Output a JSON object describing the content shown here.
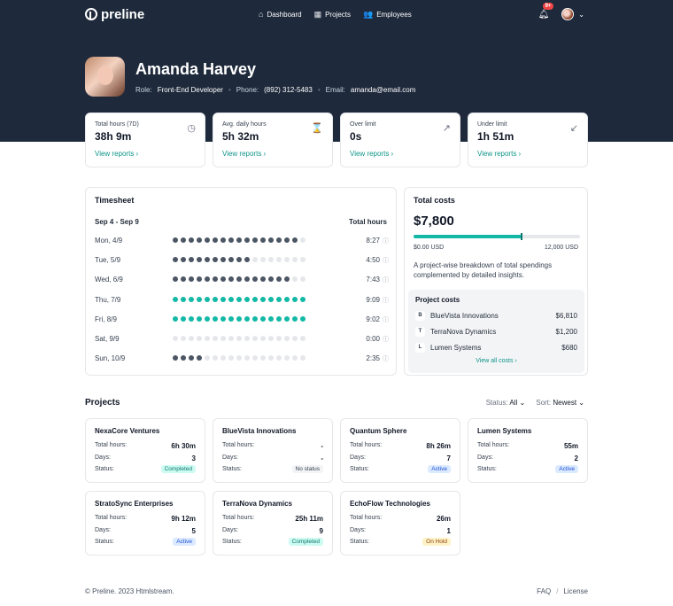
{
  "nav": {
    "brand": "preline",
    "links": [
      {
        "label": "Dashboard",
        "icon": "home-icon",
        "glyph": "⌂"
      },
      {
        "label": "Projects",
        "icon": "building-icon",
        "glyph": "▦"
      },
      {
        "label": "Employees",
        "icon": "users-icon",
        "glyph": "👥"
      }
    ],
    "notification_count": "9+"
  },
  "profile": {
    "name": "Amanda Harvey",
    "role_label": "Role:",
    "role": "Front-End Developer",
    "phone_label": "Phone:",
    "phone": "(892) 312-5483",
    "email_label": "Email:",
    "email": "amanda@email.com"
  },
  "stats": [
    {
      "label": "Total hours (7D)",
      "value": "38h 9m",
      "link": "View reports",
      "icon": "calendar-clock-icon",
      "glyph": "◷"
    },
    {
      "label": "Avg. daily hours",
      "value": "5h 32m",
      "link": "View reports",
      "icon": "hourglass-icon",
      "glyph": "⌛"
    },
    {
      "label": "Over limit",
      "value": "0s",
      "link": "View reports",
      "icon": "arrow-up-right-circle-icon",
      "glyph": "↗"
    },
    {
      "label": "Under limit",
      "value": "1h 51m",
      "link": "View reports",
      "icon": "arrow-down-left-circle-icon",
      "glyph": "↙"
    }
  ],
  "timesheet": {
    "title": "Timesheet",
    "range": "Sep 4 - Sep 9",
    "total_label": "Total hours",
    "rows": [
      {
        "day": "Mon, 4/9",
        "hours": "8:27",
        "filled": 16,
        "color": "dark"
      },
      {
        "day": "Tue, 5/9",
        "hours": "4:50",
        "filled": 10,
        "color": "dark"
      },
      {
        "day": "Wed, 6/9",
        "hours": "7:43",
        "filled": 15,
        "color": "dark"
      },
      {
        "day": "Thu, 7/9",
        "hours": "9:09",
        "filled": 17,
        "color": "teal"
      },
      {
        "day": "Fri, 8/9",
        "hours": "9:02",
        "filled": 17,
        "color": "teal"
      },
      {
        "day": "Sat, 9/9",
        "hours": "0:00",
        "filled": 0,
        "color": "dark"
      },
      {
        "day": "Sun, 10/9",
        "hours": "2:35",
        "filled": 4,
        "color": "dark"
      }
    ],
    "dot_count": 17
  },
  "costs": {
    "title": "Total costs",
    "amount": "$7,800",
    "progress_fraction": 0.65,
    "min": "$0.00 USD",
    "max": "12,000 USD",
    "description": "A project-wise breakdown of total spendings complemented by detailed insights.",
    "projects_title": "Project costs",
    "items": [
      {
        "badge": "B",
        "name": "BlueVista Innovations",
        "cost": "$6,810"
      },
      {
        "badge": "T",
        "name": "TerraNova Dynamics",
        "cost": "$1,200"
      },
      {
        "badge": "L",
        "name": "Lumen Systems",
        "cost": "$680"
      }
    ],
    "view_all": "View all costs"
  },
  "projects": {
    "title": "Projects",
    "status_label": "Status:",
    "status_value": "All",
    "sort_label": "Sort:",
    "sort_value": "Newest",
    "hours_label": "Total hours:",
    "days_label": "Days:",
    "state_label": "Status:",
    "items": [
      {
        "name": "NexaCore Ventures",
        "hours": "6h 30m",
        "days": "3",
        "status": "Completed",
        "kind": "completed"
      },
      {
        "name": "BlueVista Innovations",
        "hours": "-",
        "days": "-",
        "status": "No status",
        "kind": "nostatus"
      },
      {
        "name": "Quantum Sphere",
        "hours": "8h 26m",
        "days": "7",
        "status": "Active",
        "kind": "active"
      },
      {
        "name": "Lumen Systems",
        "hours": "55m",
        "days": "2",
        "status": "Active",
        "kind": "active"
      },
      {
        "name": "StratoSync Enterprises",
        "hours": "9h 12m",
        "days": "5",
        "status": "Active",
        "kind": "active"
      },
      {
        "name": "TerraNova Dynamics",
        "hours": "25h 11m",
        "days": "9",
        "status": "Completed",
        "kind": "completed"
      },
      {
        "name": "EchoFlow Technologies",
        "hours": "26m",
        "days": "1",
        "status": "On Hold",
        "kind": "onhold"
      }
    ]
  },
  "footer": {
    "copyright": "© Preline. 2023 Htmlstream.",
    "faq": "FAQ",
    "sep": "/",
    "license": "License"
  }
}
